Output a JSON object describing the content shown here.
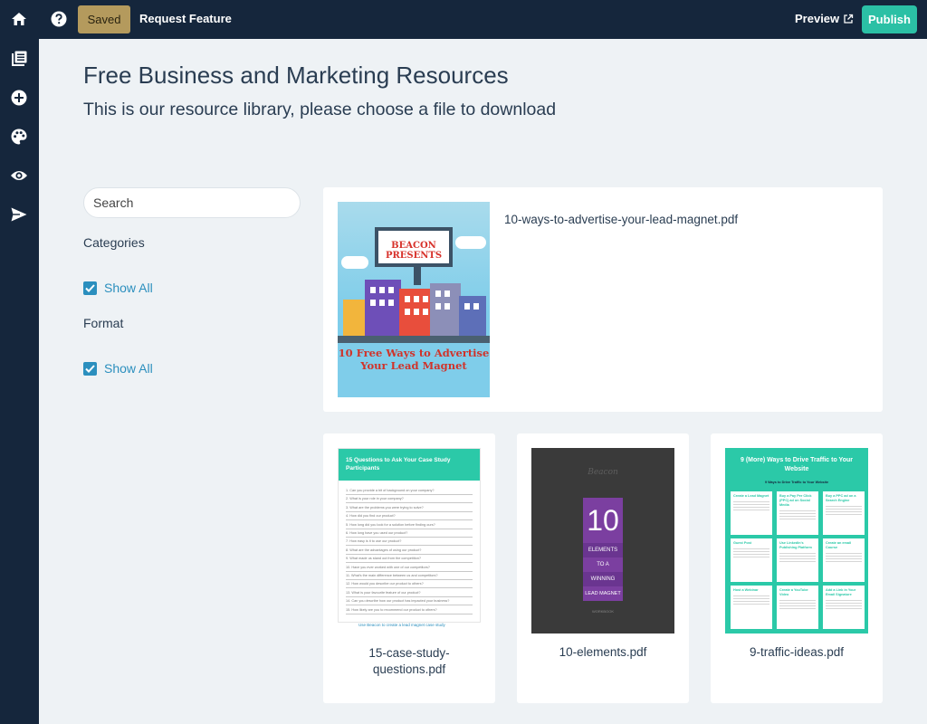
{
  "topbar": {
    "saved_label": "Saved",
    "request_feature_label": "Request Feature",
    "preview_label": "Preview",
    "publish_label": "Publish"
  },
  "sidebar": {
    "icons": [
      "home-icon",
      "pages-icon",
      "add-icon",
      "palette-icon",
      "eye-icon",
      "send-icon"
    ]
  },
  "page": {
    "title": "Free Business and Marketing Resources",
    "subtitle": "This is our resource library, please choose a file to download"
  },
  "filters": {
    "search_placeholder": "Search",
    "categories_label": "Categories",
    "categories_option": "Show All",
    "format_label": "Format",
    "format_option": "Show All"
  },
  "resources": [
    {
      "file": "10-ways-to-advertise-your-lead-magnet.pdf",
      "cover_banner": "BEACON PRESENTS",
      "cover_title": "10 Free Ways to Advertise Your Lead Magnet"
    },
    {
      "file": "15-case-study-questions.pdf",
      "cover_title": "15 Questions to Ask Your Case Study Participants",
      "cover_questions": [
        "1. Can you provide a bit of background on your company?",
        "2. What is your role in your company?",
        "3. What are the problems you were trying to solve?",
        "4. How did you find our product?",
        "5. How long did you look for a solution before finding ours?",
        "6. How long have you used our product?",
        "7. How easy is it to use our product?",
        "8. What are the advantages of using our product?",
        "9. What made us stand out from the competition?",
        "10. Have you ever worked with one of our competitors?",
        "11. What's the main difference between us and competitors?",
        "12. How would you describe our product to others?",
        "13. What is your favourite feature of our product?",
        "14. Can you describe how our product has impacted your business?",
        "15. How likely are you to recommend our product to others?"
      ],
      "cover_footer": "Use Beacon to create a lead magnet case study"
    },
    {
      "file": "10-elements.pdf",
      "cover_logo": "Beacon",
      "cover_number": "10",
      "cover_words": [
        "ELEMENTS",
        "TO A",
        "WINNING",
        "LEAD MAGNET"
      ],
      "cover_footer": "WORKBOOK"
    },
    {
      "file": "9-traffic-ideas.pdf",
      "cover_title": "9 (More) Ways to Drive Traffic to Your Website",
      "cover_subtitle": "9 Ways to Drive Traffic to Your Website",
      "cover_cells": [
        "Create a Lead Magnet",
        "Buy a Pay Per Click (PPC) ad on Social Media",
        "Buy a PPC ad on a Search Engine",
        "Guest Post",
        "Use LinkedIn's Publishing Platform",
        "Create an email Course",
        "Host a Webinar",
        "Create a YouTube Video",
        "Add a Link in Your Email Signature"
      ]
    }
  ],
  "colors": {
    "nav_bg": "#15263c",
    "accent": "#2bc0a5",
    "saved": "#b49a5d",
    "link": "#2b8fbe",
    "page_bg": "#eef2f5"
  }
}
